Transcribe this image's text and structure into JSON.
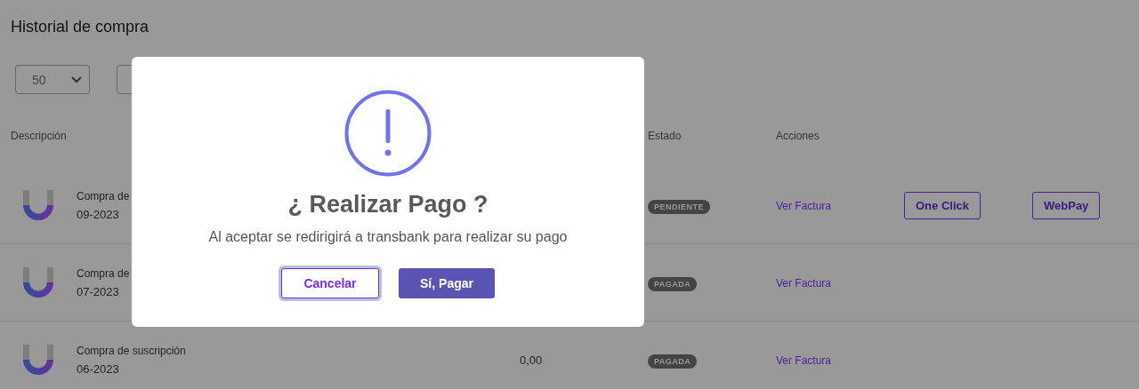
{
  "page": {
    "title": "Historial de compra"
  },
  "controls": {
    "page_size": "50"
  },
  "table": {
    "columns": [
      {
        "label": "Descripción",
        "kind": "desc"
      },
      {
        "label": "Estado",
        "kind": "status"
      },
      {
        "label": "Acciones",
        "kind": "actions"
      }
    ],
    "rows": [
      {
        "description": "Compra de",
        "period": "09-2023",
        "status": "PENDIENTE",
        "link": "Ver Factura",
        "buttons": [
          "One Click",
          "WebPay"
        ]
      },
      {
        "description": "Compra de",
        "period": "07-2023",
        "status": "PAGADA",
        "link": "Ver Factura"
      },
      {
        "description": "Compra de suscripción",
        "period": "06-2023",
        "amount": "0,00",
        "status": "PAGADA",
        "link": "Ver Factura"
      }
    ]
  },
  "dialog": {
    "title": "¿ Realizar Pago ?",
    "message": "Al aceptar se redirigirá a transbank para realizar su pago",
    "cancel": {
      "label": "Cancelar",
      "focused": true
    },
    "confirm": {
      "label": "Sí, Pagar"
    }
  }
}
